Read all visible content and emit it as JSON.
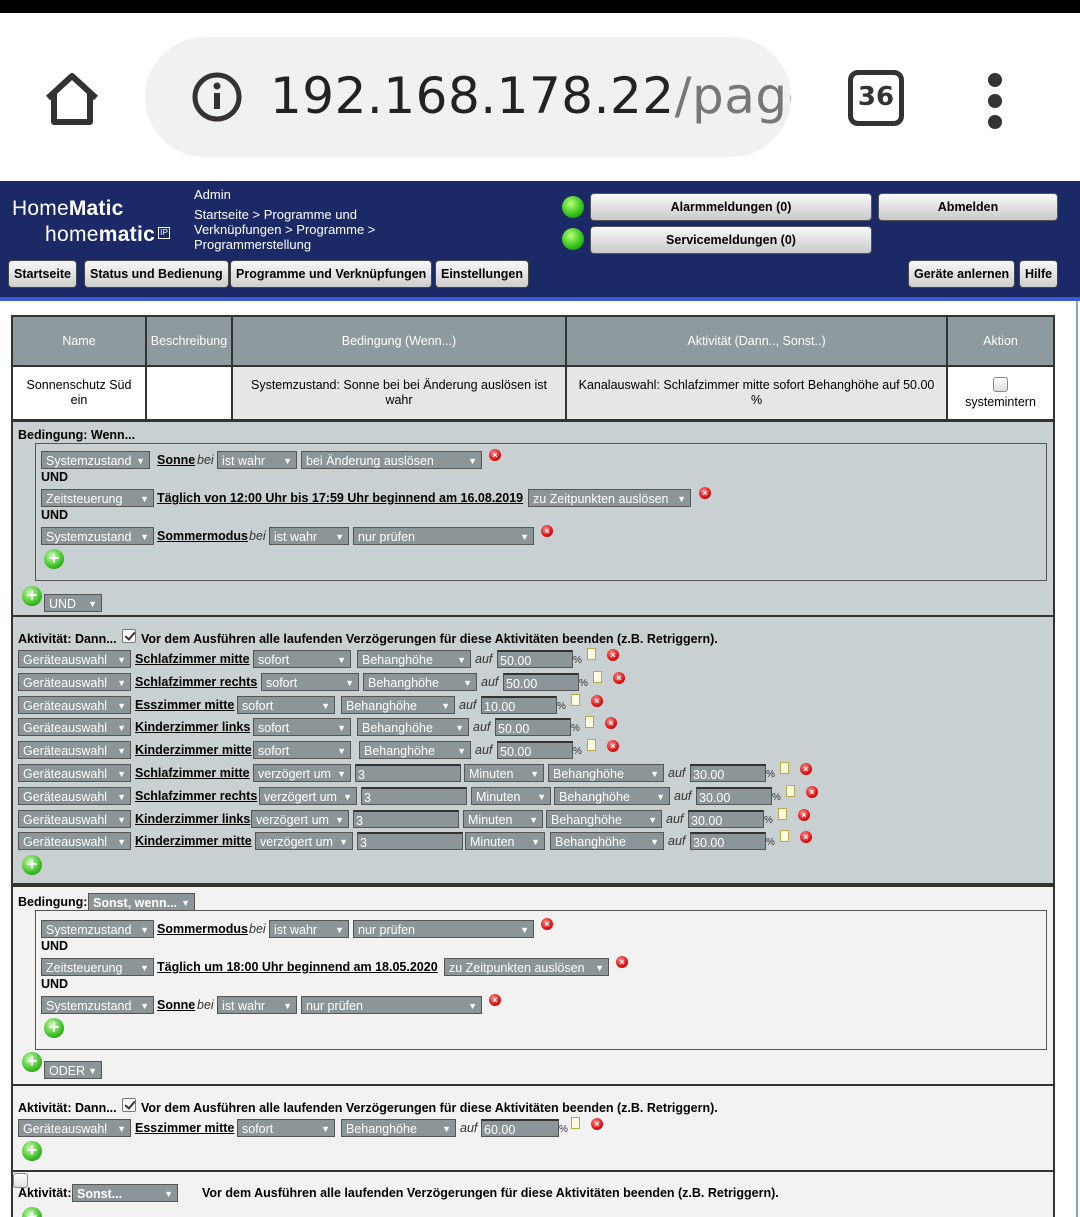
{
  "browser": {
    "url_host": "192.168.178.22",
    "url_path": "/pages,",
    "tab_count": "36",
    "icons": [
      "home-icon",
      "info-icon",
      "tabs-icon",
      "menu-icon"
    ]
  },
  "header": {
    "logo_line1_a": "Home",
    "logo_line1_b": "Matic",
    "logo_line2_a": "home",
    "logo_line2_b": "matic",
    "logo_badge": "IP",
    "user": "Admin",
    "breadcrumb": "Startseite > Programme und Verknüpfungen > Programme > Programmerstellung",
    "alarm_button": "Alarmmeldungen (0)",
    "service_button": "Servicemeldungen (0)",
    "logout_button": "Abmelden",
    "nav": [
      "Startseite",
      "Status und Bedienung",
      "Programme und Verknüpfungen",
      "Einstellungen"
    ],
    "right_nav": [
      "Geräte anlernen",
      "Hilfe"
    ]
  },
  "program_table": {
    "columns": [
      "Name",
      "Beschreibung",
      "Bedingung (Wenn...)",
      "Aktivität (Dann.., Sonst..)",
      "Aktion"
    ],
    "row": {
      "name": "Sonnenschutz Süd ein",
      "description": "",
      "condition": "Systemzustand: Sonne bei bei Änderung auslösen ist wahr",
      "activity": "Kanalauswahl: Schlafzimmer mitte sofort Behanghöhe auf 50.00 %",
      "action": "systemintern"
    }
  },
  "cond1": {
    "label": "Bedingung: Wenn...",
    "und": "UND",
    "rows": [
      {
        "type": "Systemzustand",
        "link": "Sonne",
        "bei": "bei",
        "state": "ist wahr",
        "trigger": "bei Änderung auslösen"
      },
      {
        "type": "Zeitsteuerung",
        "link": "Täglich von 12:00 Uhr bis 17:59 Uhr beginnend am 16.08.2019",
        "trigger": "zu Zeitpunkten auslösen"
      },
      {
        "type": "Systemzustand",
        "link": "Sommermodus",
        "bei": "bei",
        "state": "ist wahr",
        "trigger": "nur prüfen"
      }
    ],
    "operator": "UND"
  },
  "act1": {
    "label": "Aktivität: Dann...",
    "note": "Vor dem Ausführen alle laufenden Verzögerungen für diese Aktivitäten beenden (z.B. Retriggern).",
    "auf": "auf",
    "pct": "%",
    "rows": [
      {
        "sel": "Geräteauswahl",
        "dev": "Schlafzimmer mitte",
        "timing": "sofort",
        "param": "Behanghöhe",
        "value": "50.00"
      },
      {
        "sel": "Geräteauswahl",
        "dev": "Schlafzimmer rechts",
        "timing": "sofort",
        "param": "Behanghöhe",
        "value": "50.00"
      },
      {
        "sel": "Geräteauswahl",
        "dev": "Esszimmer mitte",
        "timing": "sofort",
        "param": "Behanghöhe",
        "value": "10.00"
      },
      {
        "sel": "Geräteauswahl",
        "dev": "Kinderzimmer links",
        "timing": "sofort",
        "param": "Behanghöhe",
        "value": "50.00"
      },
      {
        "sel": "Geräteauswahl",
        "dev": "Kinderzimmer mitte",
        "timing": "sofort",
        "param": "Behanghöhe",
        "value": "50.00"
      },
      {
        "sel": "Geräteauswahl",
        "dev": "Schlafzimmer mitte",
        "timing": "verzögert um",
        "delay": "3",
        "unit": "Minuten",
        "param": "Behanghöhe",
        "value": "30.00"
      },
      {
        "sel": "Geräteauswahl",
        "dev": "Schlafzimmer rechts",
        "timing": "verzögert um",
        "delay": "3",
        "unit": "Minuten",
        "param": "Behanghöhe",
        "value": "30.00"
      },
      {
        "sel": "Geräteauswahl",
        "dev": "Kinderzimmer links",
        "timing": "verzögert um",
        "delay": "3",
        "unit": "Minuten",
        "param": "Behanghöhe",
        "value": "30.00"
      },
      {
        "sel": "Geräteauswahl",
        "dev": "Kinderzimmer mitte",
        "timing": "verzögert um",
        "delay": "3",
        "unit": "Minuten",
        "param": "Behanghöhe",
        "value": "30.00"
      }
    ]
  },
  "cond2": {
    "label": "Bedingung:",
    "mode": "Sonst, wenn...",
    "und": "UND",
    "rows": [
      {
        "type": "Systemzustand",
        "link": "Sommermodus",
        "bei": "bei",
        "state": "ist wahr",
        "trigger": "nur prüfen"
      },
      {
        "type": "Zeitsteuerung",
        "link": "Täglich um 18:00 Uhr beginnend am 18.05.2020",
        "trigger": "zu Zeitpunkten auslösen"
      },
      {
        "type": "Systemzustand",
        "link": "Sonne",
        "bei": "bei",
        "state": "ist wahr",
        "trigger": "nur prüfen"
      }
    ],
    "operator": "ODER"
  },
  "act2": {
    "label": "Aktivität: Dann...",
    "note": "Vor dem Ausführen alle laufenden Verzögerungen für diese Aktivitäten beenden (z.B. Retriggern).",
    "row": {
      "sel": "Geräteauswahl",
      "dev": "Esszimmer mitte",
      "timing": "sofort",
      "param": "Behanghöhe",
      "auf": "auf",
      "value": "60.00",
      "pct": "%"
    }
  },
  "act3": {
    "label": "Aktivität:",
    "mode": "Sonst...",
    "note": "Vor dem Ausführen alle laufenden Verzögerungen für diese Aktivitäten beenden (z.B. Retriggern)."
  }
}
